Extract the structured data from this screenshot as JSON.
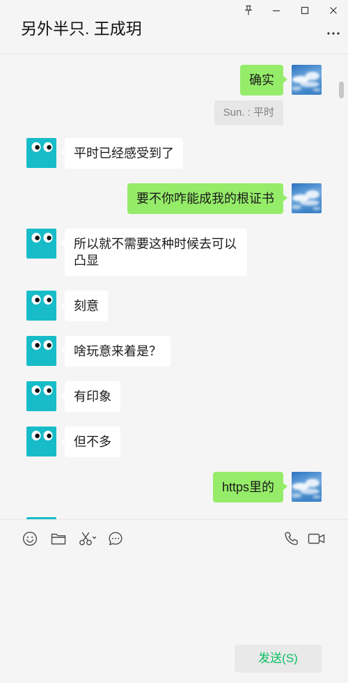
{
  "window": {
    "title": "另外半只. 王成玥",
    "controls": [
      "pin-icon",
      "minimize-icon",
      "maximize-icon",
      "close-icon"
    ],
    "more_icon": "more-icon"
  },
  "messages": [
    {
      "outgoing": true,
      "text": "确实",
      "quote": "Sun. : 平时"
    },
    {
      "outgoing": false,
      "text": "平时已经感受到了"
    },
    {
      "outgoing": true,
      "text": "要不你咋能成我的根证书"
    },
    {
      "outgoing": false,
      "text": "所以就不需要这种时候去可以凸显"
    },
    {
      "outgoing": false,
      "text": "刻意"
    },
    {
      "outgoing": false,
      "text": "啥玩意来着是？"
    },
    {
      "outgoing": false,
      "text": "有印象"
    },
    {
      "outgoing": false,
      "text": "但不多"
    },
    {
      "outgoing": true,
      "text": "https里的"
    }
  ],
  "toolbar": {
    "left_icons": [
      "emoji-icon",
      "folder-icon",
      "scissors-icon",
      "chat-history-icon"
    ],
    "right_icons": [
      "phone-icon",
      "video-call-icon"
    ]
  },
  "input": {
    "value": "",
    "send_label": "发送(S)"
  },
  "colors": {
    "background": "#f5f5f5",
    "self_bubble": "#95ec69",
    "contact_bubble": "#ffffff",
    "contact_avatar": "#17bcc8",
    "quote_background": "#e7e7e7",
    "send_text": "#07c160",
    "send_button": "#e9e9e9"
  }
}
